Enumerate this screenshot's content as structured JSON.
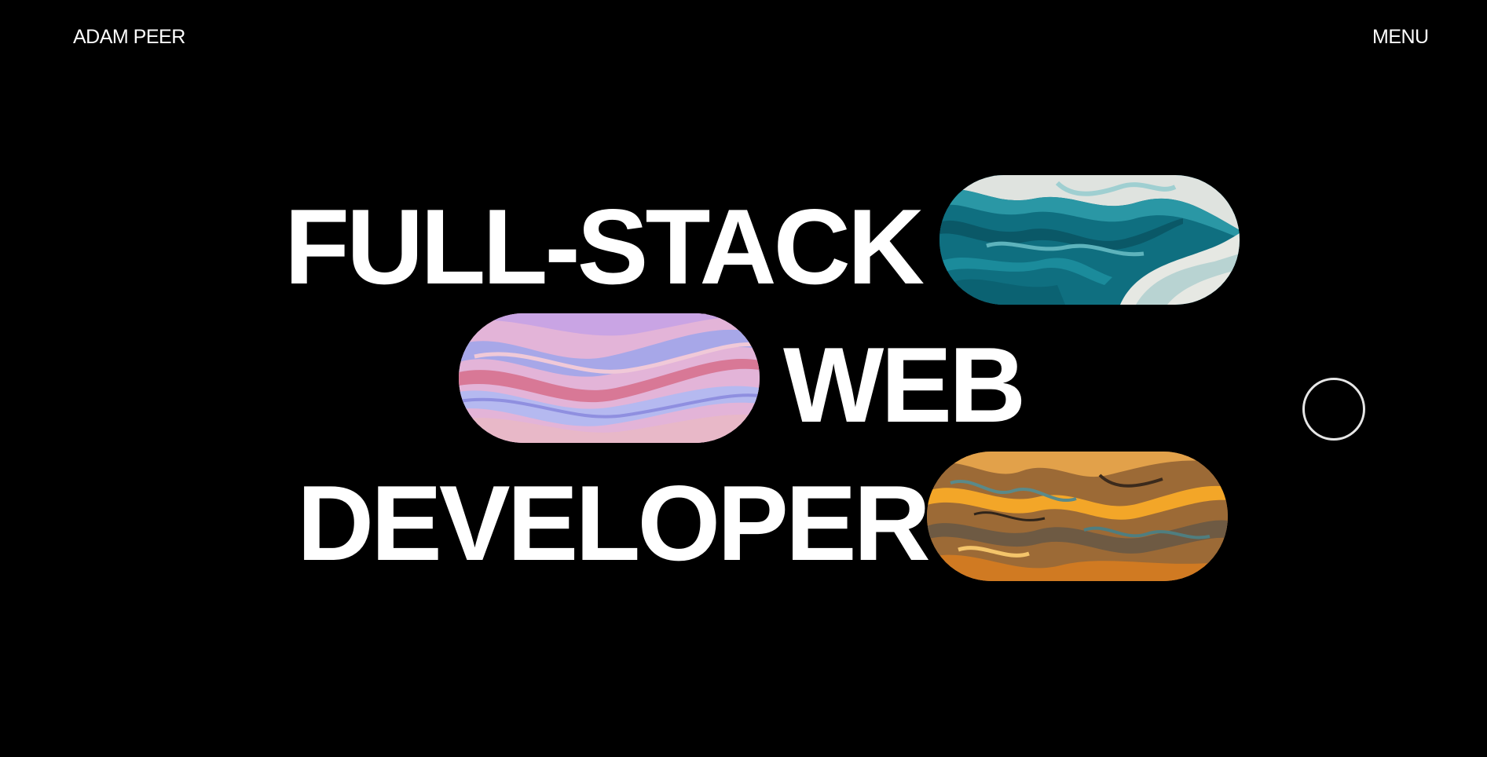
{
  "header": {
    "brand": "ADAM PEER",
    "menu_label": "MENU"
  },
  "hero": {
    "lines": [
      "FULL-STACK",
      "WEB",
      "DEVELOPER"
    ],
    "images": [
      {
        "name": "teal marble swirl",
        "color": "#127d8d"
      },
      {
        "name": "pink lilac marble swirl",
        "color": "#d8a8d8"
      },
      {
        "name": "amber marble swirl",
        "color": "#b97a35"
      }
    ]
  },
  "colors": {
    "background": "#000000",
    "text": "#ffffff",
    "cursor_ring": "#e6e6e6"
  }
}
